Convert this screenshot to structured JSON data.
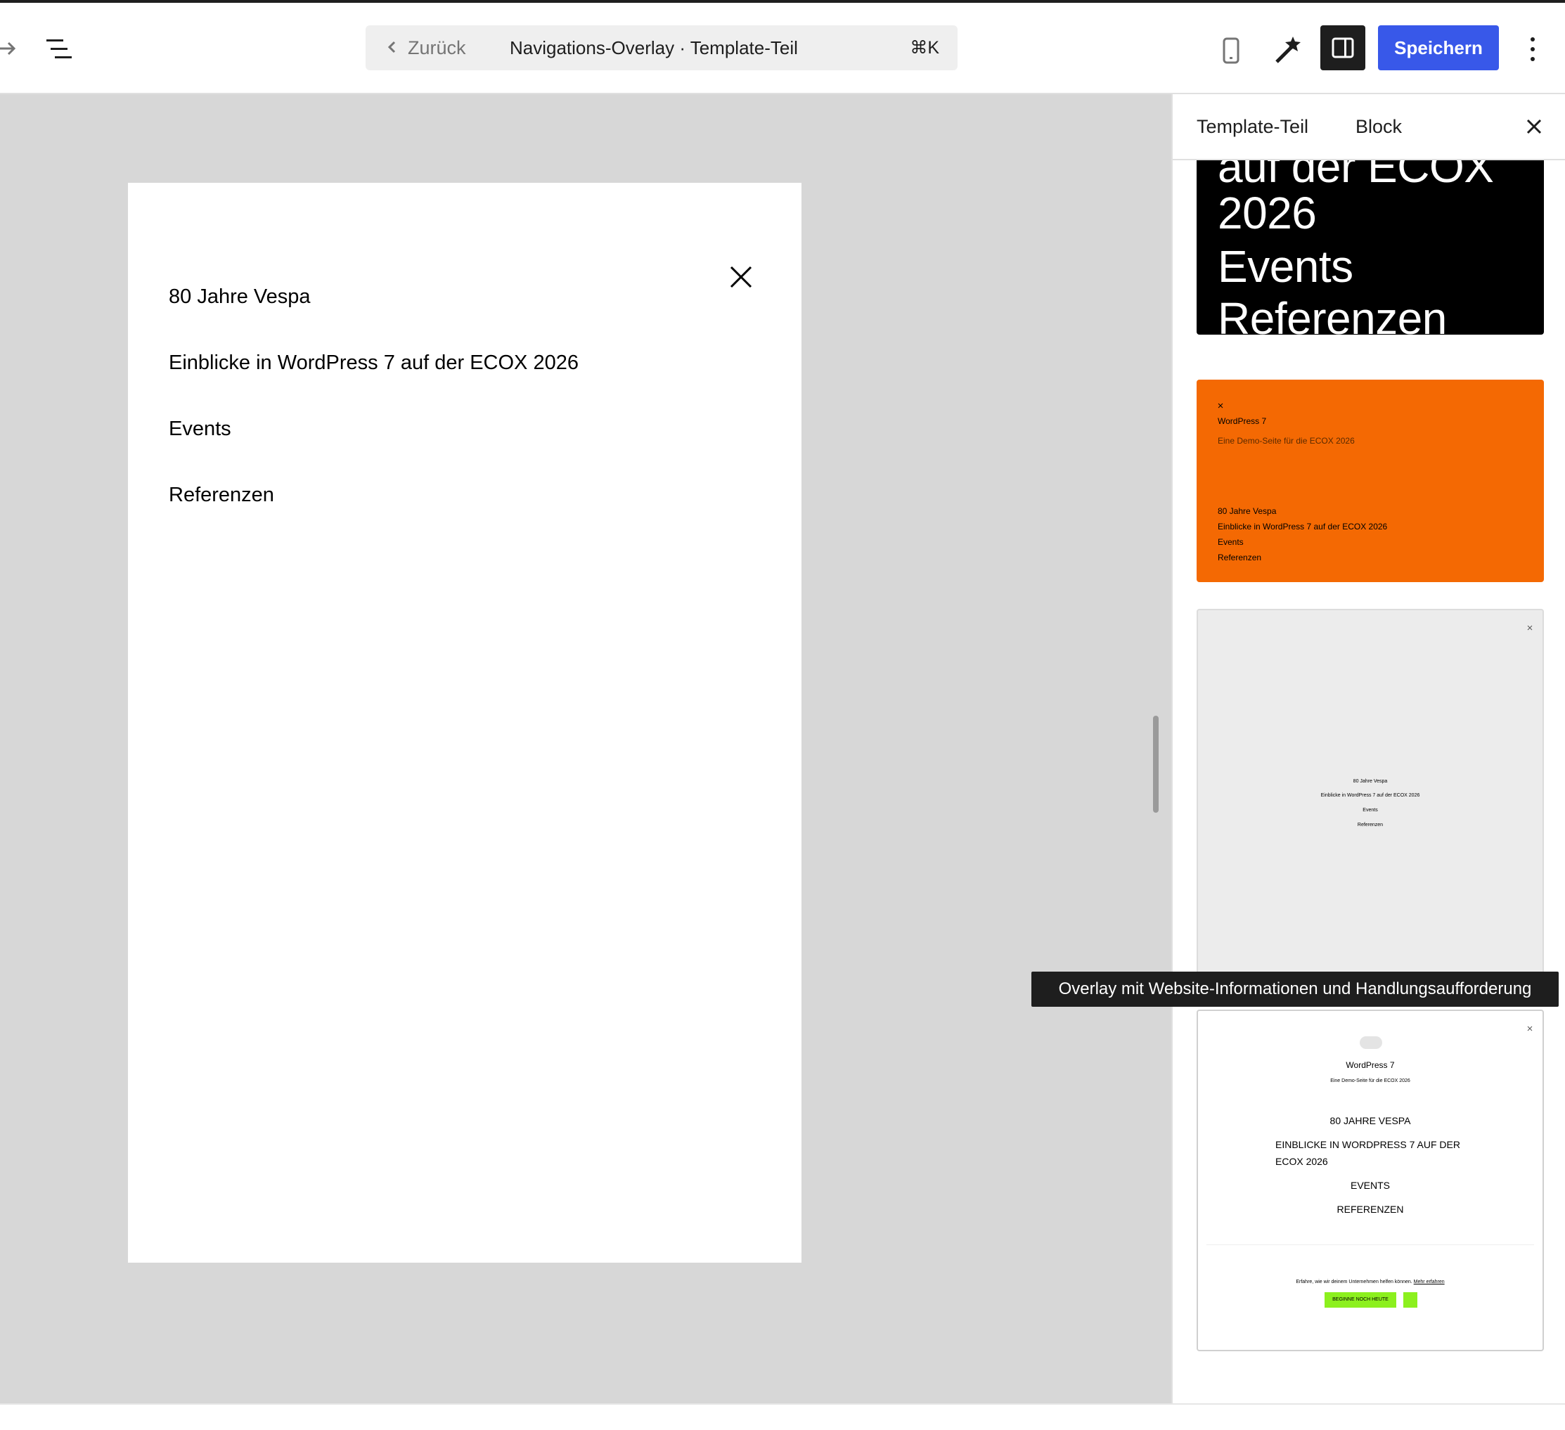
{
  "header": {
    "back_label": "Zurück",
    "document_title": "Navigations-Overlay · Template-Teil",
    "shortcut": "⌘K",
    "save_label": "Speichern",
    "accent_color": "#3858e9"
  },
  "icons": {
    "forward": "arrow-right-icon",
    "list_view": "list-view-icon",
    "preview": "mobile-device-icon",
    "styles": "magic-wand-icon",
    "settings": "sidebar-settings-icon",
    "more": "more-vertical-icon",
    "close": "close-icon"
  },
  "canvas": {
    "nav_items": [
      "80 Jahre Vespa",
      "Einblicke in WordPress 7 auf der ECOX 2026",
      "Events",
      "Referenzen"
    ]
  },
  "sidebar": {
    "tabs": [
      "Template-Teil",
      "Block"
    ],
    "previews": {
      "black": {
        "lines": [
          "auf der ECOX",
          "2026",
          "Events",
          "Referenzen"
        ]
      },
      "orange": {
        "site_title": "WordPress 7",
        "tagline": "Eine Demo-Seite für die ECOX 2026",
        "nav": [
          "80 Jahre Vespa",
          "Einblicke in WordPress 7 auf der ECOX 2026",
          "Events",
          "Referenzen"
        ],
        "color": "#f46903"
      },
      "gray": {
        "nav": [
          "80 Jahre Vespa",
          "Einblicke in WordPress 7 auf der ECOX 2026",
          "Events",
          "Referenzen"
        ]
      },
      "white": {
        "site_title": "WordPress 7",
        "tagline": "Eine Demo-Seite für die ECOX 2026",
        "nav": [
          "80 JAHRE VESPA",
          "EINBLICKE IN WORDPRESS 7 AUF DER",
          "ECOX 2026",
          "EVENTS",
          "REFERENZEN"
        ],
        "cta_text": "Erfahre, wie wir deinem Unternehmen helfen können.",
        "cta_link": "Mehr erfahren",
        "cta_button": "BEGINNE NOCH HEUTE",
        "cta_color": "#8cf01e"
      }
    },
    "tooltip": "Overlay mit Website-Informationen und Handlungsaufforderung"
  }
}
